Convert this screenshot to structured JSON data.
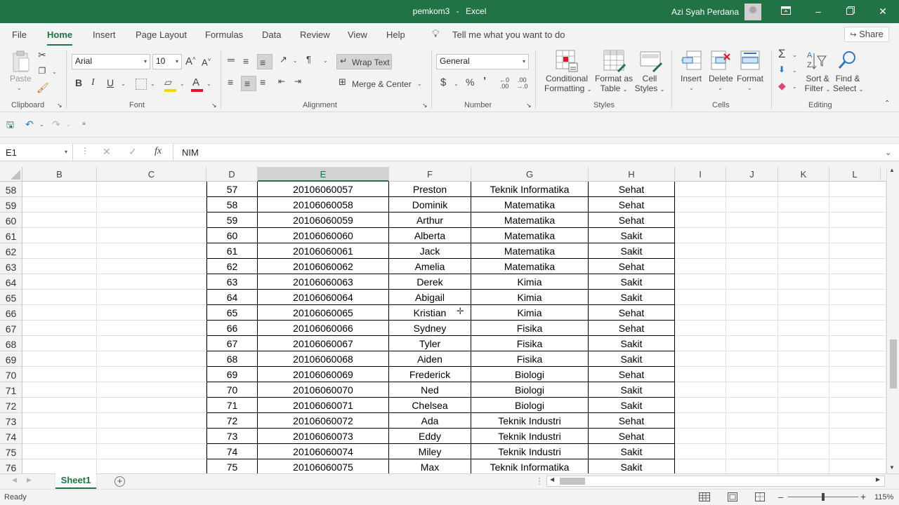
{
  "title_bar": {
    "file_name": "pemkom3",
    "separator": "-",
    "app_name": "Excel",
    "user_name": "Azi Syah Perdana"
  },
  "menu": {
    "tabs": [
      "File",
      "Home",
      "Insert",
      "Page Layout",
      "Formulas",
      "Data",
      "Review",
      "View",
      "Help"
    ],
    "active_tab": "Home",
    "tell_me": "Tell me what you want to do",
    "share": "Share"
  },
  "ribbon": {
    "clipboard": {
      "paste": "Paste",
      "label": "Clipboard"
    },
    "font": {
      "name": "Arial",
      "size": "10",
      "bold": "B",
      "italic": "I",
      "underline": "U",
      "label": "Font",
      "grow": "A",
      "shrink": "A",
      "color_letter": "A"
    },
    "alignment": {
      "wrap_text": "Wrap Text",
      "merge_center": "Merge & Center",
      "label": "Alignment"
    },
    "number": {
      "format": "General",
      "currency": "$",
      "percent": "%",
      "comma": "’",
      "inc_dec": ".00",
      "label": "Number"
    },
    "styles": {
      "conditional_1": "Conditional",
      "conditional_2": "Formatting",
      "format_as_1": "Format as",
      "format_as_2": "Table",
      "cell_styles_1": "Cell",
      "cell_styles_2": "Styles",
      "label": "Styles"
    },
    "cells": {
      "insert": "Insert",
      "delete": "Delete",
      "format": "Format",
      "label": "Cells"
    },
    "editing": {
      "sort_1": "Sort &",
      "sort_2": "Filter",
      "find_1": "Find &",
      "find_2": "Select",
      "label": "Editing"
    },
    "colors": {
      "accent": "#217346",
      "fill": "#ffd400",
      "font_red": "#e81123"
    }
  },
  "formula_bar": {
    "name_box": "E1",
    "fx": "fx",
    "content": "NIM"
  },
  "columns": [
    "B",
    "C",
    "D",
    "E",
    "F",
    "G",
    "H",
    "I",
    "J",
    "K",
    "L"
  ],
  "selected_column": "E",
  "rows": [
    {
      "rownum": "58",
      "d": "57",
      "e": "20106060057",
      "f": "Preston",
      "g": "Teknik Informatika",
      "h": "Sehat"
    },
    {
      "rownum": "59",
      "d": "58",
      "e": "20106060058",
      "f": "Dominik",
      "g": "Matematika",
      "h": "Sehat"
    },
    {
      "rownum": "60",
      "d": "59",
      "e": "20106060059",
      "f": "Arthur",
      "g": "Matematika",
      "h": "Sehat"
    },
    {
      "rownum": "61",
      "d": "60",
      "e": "20106060060",
      "f": "Alberta",
      "g": "Matematika",
      "h": "Sakit"
    },
    {
      "rownum": "62",
      "d": "61",
      "e": "20106060061",
      "f": "Jack",
      "g": "Matematika",
      "h": "Sakit"
    },
    {
      "rownum": "63",
      "d": "62",
      "e": "20106060062",
      "f": "Amelia",
      "g": "Matematika",
      "h": "Sehat"
    },
    {
      "rownum": "64",
      "d": "63",
      "e": "20106060063",
      "f": "Derek",
      "g": "Kimia",
      "h": "Sakit"
    },
    {
      "rownum": "65",
      "d": "64",
      "e": "20106060064",
      "f": "Abigail",
      "g": "Kimia",
      "h": "Sakit"
    },
    {
      "rownum": "66",
      "d": "65",
      "e": "20106060065",
      "f": "Kristian",
      "g": "Kimia",
      "h": "Sehat"
    },
    {
      "rownum": "67",
      "d": "66",
      "e": "20106060066",
      "f": "Sydney",
      "g": "Fisika",
      "h": "Sehat"
    },
    {
      "rownum": "68",
      "d": "67",
      "e": "20106060067",
      "f": "Tyler",
      "g": "Fisika",
      "h": "Sakit"
    },
    {
      "rownum": "69",
      "d": "68",
      "e": "20106060068",
      "f": "Aiden",
      "g": "Fisika",
      "h": "Sakit"
    },
    {
      "rownum": "70",
      "d": "69",
      "e": "20106060069",
      "f": "Frederick",
      "g": "Biologi",
      "h": "Sehat"
    },
    {
      "rownum": "71",
      "d": "70",
      "e": "20106060070",
      "f": "Ned",
      "g": "Biologi",
      "h": "Sakit"
    },
    {
      "rownum": "72",
      "d": "71",
      "e": "20106060071",
      "f": "Chelsea",
      "g": "Biologi",
      "h": "Sakit"
    },
    {
      "rownum": "73",
      "d": "72",
      "e": "20106060072",
      "f": "Ada",
      "g": "Teknik Industri",
      "h": "Sehat"
    },
    {
      "rownum": "74",
      "d": "73",
      "e": "20106060073",
      "f": "Eddy",
      "g": "Teknik Industri",
      "h": "Sehat"
    },
    {
      "rownum": "75",
      "d": "74",
      "e": "20106060074",
      "f": "Miley",
      "g": "Teknik Industri",
      "h": "Sakit"
    },
    {
      "rownum": "76",
      "d": "75",
      "e": "20106060075",
      "f": "Max",
      "g": "Teknik Informatika",
      "h": "Sakit"
    }
  ],
  "sheets": [
    "Sheet1"
  ],
  "active_sheet": "Sheet1",
  "status": {
    "ready": "Ready",
    "zoom": "115%"
  }
}
